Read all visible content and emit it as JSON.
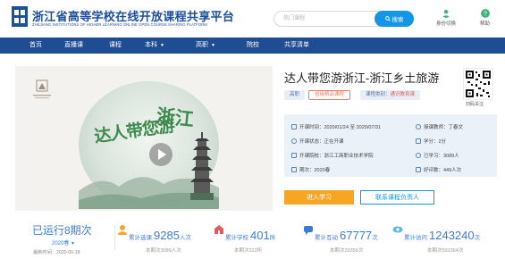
{
  "header": {
    "title": "浙江省高等学校在线开放课程共享平台",
    "subtitle": "ZHEJIANG INSTITUTIONS OF HIGHER LEARNING ONLINE OPEN COURSE SHARING PLATFORM",
    "search_placeholder": "热门课程",
    "search_button": "搜索",
    "switch_identity": "身份切换",
    "help": "帮助"
  },
  "nav": {
    "items": [
      {
        "label": "首页"
      },
      {
        "label": "直播课"
      },
      {
        "label": "课程"
      },
      {
        "label": "本科",
        "caret": "▼"
      },
      {
        "label": "高职",
        "caret": "▼"
      },
      {
        "label": "院校"
      },
      {
        "label": "共享清单"
      }
    ]
  },
  "hero": {
    "calligraphy_1": "达人带您游",
    "calligraphy_2": "浙江",
    "icon": "play-icon"
  },
  "course": {
    "title": "达人带您游浙江-浙江乡土旅游",
    "level_tag": "高职",
    "quality_tag": "省级精品课程",
    "type_label": "课程类别：",
    "type_value": "通识教育课",
    "qr_label": "扫码关注"
  },
  "info": {
    "open_time": "开课时间：2020/01/24 至 2020/07/31",
    "status": "开课状态：正在开课",
    "school": "开课院校：浙江工商职业技术学院",
    "term": "期次：2020春",
    "teacher": "授课教师：丁春文",
    "credit": "学分：2分",
    "students": "已学习：3089人",
    "reviews": "好评数：449人次"
  },
  "actions": {
    "join": "进入学习",
    "contact": "联系课程负责人"
  },
  "stats": {
    "run_times": "已运行8期次",
    "term": "2020春",
    "update": "最新时间：2020-06-18",
    "items": [
      {
        "label": "累计选课",
        "number": "9285",
        "unit": "人次",
        "sub": "本期次3089人次",
        "color": "#f5a623"
      },
      {
        "label": "累计学校",
        "number": "401",
        "unit": "所",
        "sub": "本期次222所",
        "color": "#e05c5c"
      },
      {
        "label": "累计互动",
        "number": "67777",
        "unit": "次",
        "sub": "本期次29356次",
        "color": "#3a7bd5"
      },
      {
        "label": "累计访问",
        "number": "1243240",
        "unit": "次",
        "sub": "本期次592364次",
        "color": "#5bb5e8"
      }
    ]
  }
}
